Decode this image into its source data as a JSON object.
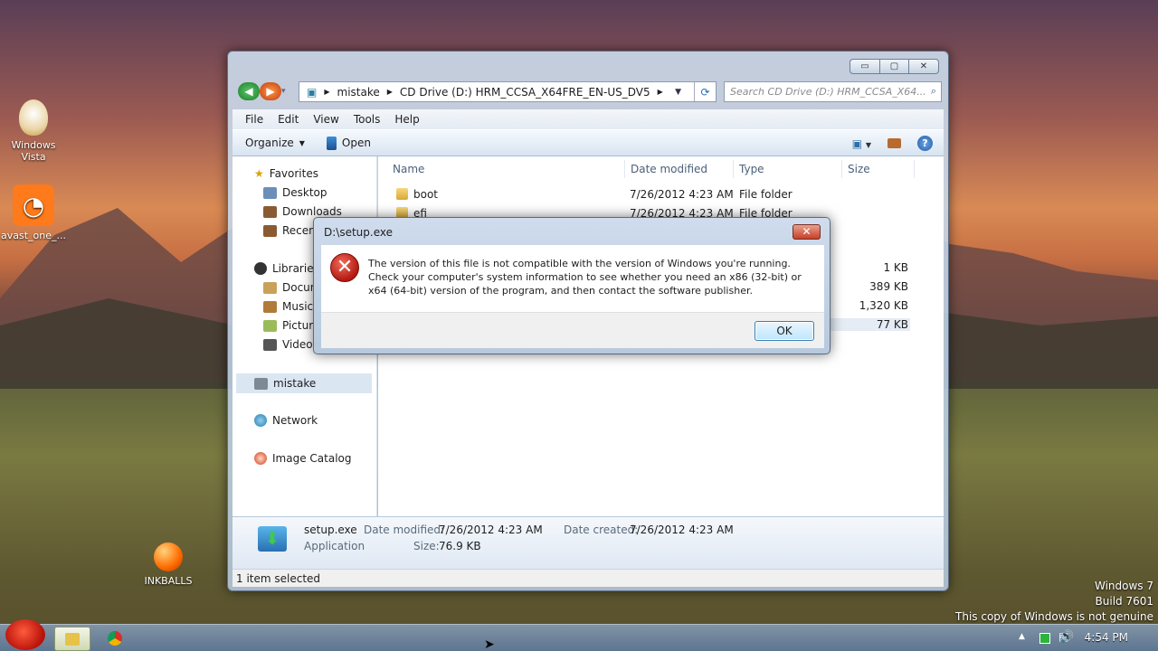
{
  "desktop": {
    "icons": [
      {
        "label": "Windows Vista"
      },
      {
        "label": "avast_one_..."
      },
      {
        "label": "INKBALLS"
      }
    ],
    "watermark": {
      "line1": "Windows 7",
      "line2": "Build 7601",
      "line3": "This copy of Windows is not genuine"
    }
  },
  "explorer": {
    "caption_buttons": {
      "minimize": "▭",
      "maximize": "▢",
      "close": "✕"
    },
    "address": {
      "crumbs": [
        "mistake",
        "CD Drive (D:) HRM_CCSA_X64FRE_EN-US_DV5"
      ]
    },
    "search": {
      "placeholder": "Search CD Drive (D:) HRM_CCSA_X64..."
    },
    "menu": [
      "File",
      "Edit",
      "View",
      "Tools",
      "Help"
    ],
    "toolbar": {
      "organize": "Organize",
      "open": "Open"
    },
    "nav": {
      "favorites": "Favorites",
      "desktop": "Desktop",
      "downloads": "Downloads",
      "recent": "Recent",
      "libraries": "Libraries",
      "documents": "Docum",
      "music": "Music",
      "pictures": "Picture",
      "videos": "Videos",
      "mistake": "mistake",
      "network": "Network",
      "image_catalog": "Image Catalog"
    },
    "columns": {
      "name": "Name",
      "date": "Date modified",
      "type": "Type",
      "size": "Size"
    },
    "rows": [
      {
        "name": "boot",
        "date": "7/26/2012 4:23 AM",
        "type": "File folder",
        "size": ""
      },
      {
        "name": "efi",
        "date": "7/26/2012 4:23 AM",
        "type": "File folder",
        "size": ""
      }
    ],
    "sizes_visible": [
      "1 KB",
      "389 KB",
      "1,320 KB",
      "77 KB"
    ],
    "details": {
      "filename": "setup.exe",
      "kind": "Application",
      "modified_label": "Date modified:",
      "modified": "7/26/2012 4:23 AM",
      "created_label": "Date created:",
      "created": "7/26/2012 4:23 AM",
      "size_label": "Size:",
      "size": "76.9 KB"
    },
    "status": "1 item selected"
  },
  "dialog": {
    "title": "D:\\setup.exe",
    "close": "✕",
    "message": "The version of this file is not compatible with the version of Windows you're running. Check your computer's system information to see whether you need an x86 (32-bit) or x64 (64-bit) version of the program, and then contact the software publisher.",
    "ok": "OK"
  },
  "taskbar": {
    "clock": "4:54 PM"
  },
  "colors": {
    "accent": "#3c7fb1",
    "error": "#c0271c"
  }
}
